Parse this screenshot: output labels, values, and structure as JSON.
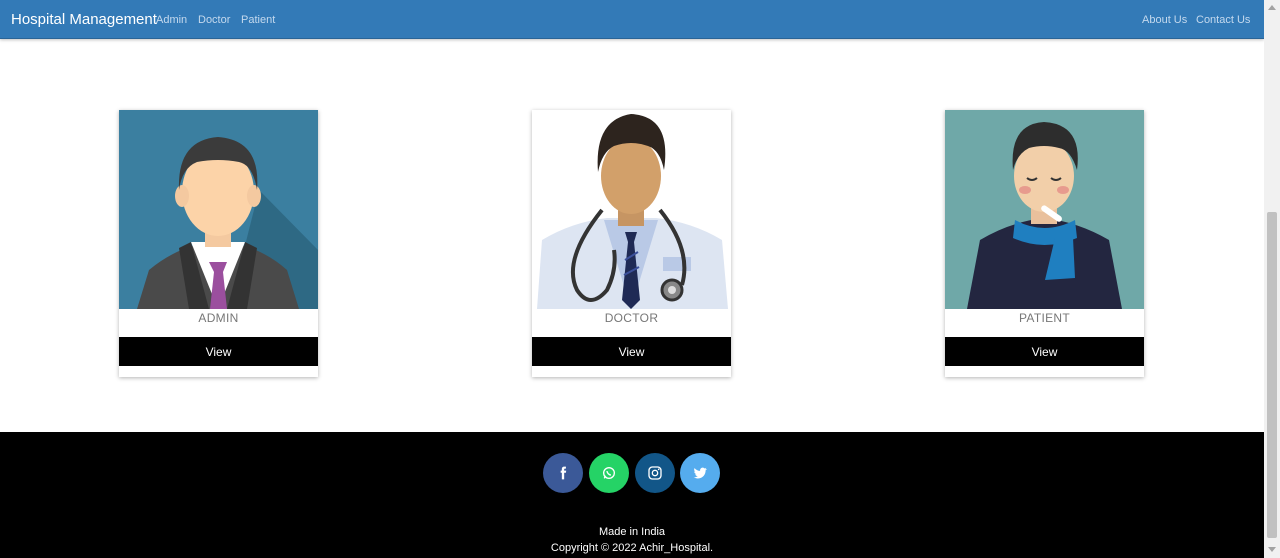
{
  "navbar": {
    "brand": "Hospital Management",
    "left_links": [
      "Admin",
      "Doctor",
      "Patient"
    ],
    "right_links": [
      "About Us",
      "Contact Us"
    ]
  },
  "cards": [
    {
      "label": "ADMIN",
      "button": "View"
    },
    {
      "label": "DOCTOR",
      "button": "View"
    },
    {
      "label": "PATIENT",
      "button": "View"
    }
  ],
  "footer": {
    "social": [
      {
        "icon": "facebook-icon",
        "color": "#3b5998"
      },
      {
        "icon": "whatsapp-icon",
        "color": "#25d366"
      },
      {
        "icon": "instagram-icon",
        "color": "#125688"
      },
      {
        "icon": "twitter-icon",
        "color": "#55acee"
      }
    ],
    "made_in": "Made in India",
    "copyright": "Copyright © 2022 Achir_Hospital."
  },
  "colors": {
    "navbar": "#337ab7",
    "footer": "#000000",
    "button": "#000000"
  }
}
